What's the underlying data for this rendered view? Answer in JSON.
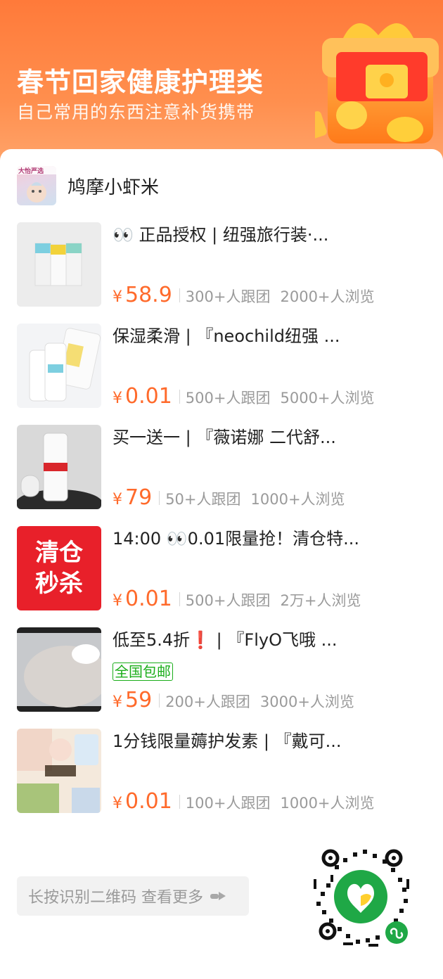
{
  "banner": {
    "title": "春节回家健康护理类",
    "subtitle": "自己常用的东西注意补货携带"
  },
  "store": {
    "name": "鸠摩小虾米",
    "avatar_text": "大怡严选"
  },
  "items": [
    {
      "title": "👀 正品授权 | 纽强旅行装·...",
      "yen": "¥",
      "price": "58.9",
      "group": "300+人跟团",
      "views": "2000+人浏览"
    },
    {
      "title": "保湿柔滑 | 『neochild纽强 ...",
      "yen": "¥",
      "price": "0.01",
      "group": "500+人跟团",
      "views": "5000+人浏览"
    },
    {
      "title": "买一送一 | 『薇诺娜 二代舒...",
      "yen": "¥",
      "price": "79",
      "group": "50+人跟团",
      "views": "1000+人浏览"
    },
    {
      "title": "14:00 👀0.01限量抢！清仓特...",
      "yen": "¥",
      "price": "0.01",
      "group": "500+人跟团",
      "views": "2万+人浏览",
      "thumb_text_1": "清仓",
      "thumb_text_2": "秒杀"
    },
    {
      "title": "低至5.4折❗ | 『FlyO飞哦 ...",
      "badge": "全国包邮",
      "yen": "¥",
      "price": "59",
      "group": "200+人跟团",
      "views": "3000+人浏览"
    },
    {
      "title": "1分钱限量薅护发素 | 『戴可...",
      "yen": "¥",
      "price": "0.01",
      "group": "100+人跟团",
      "views": "1000+人浏览"
    }
  ],
  "footer": {
    "hint": "长按识别二维码 查看更多"
  },
  "colors": {
    "accent": "#ff6a2b",
    "banner": "#ff7a3a",
    "badge_green": "#1aad19",
    "sale_red": "#e8202a"
  }
}
